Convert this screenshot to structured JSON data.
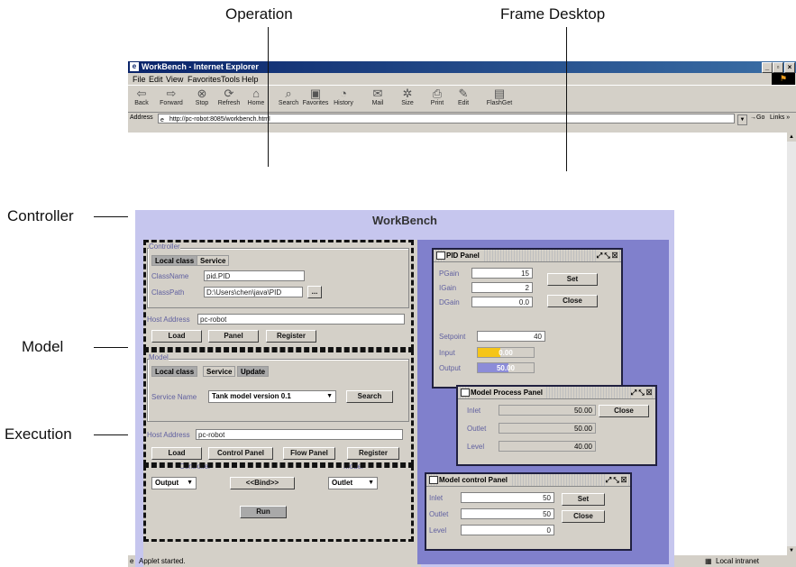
{
  "callouts": {
    "operation": "Operation",
    "frame_desktop": "Frame Desktop",
    "controller": "Controller",
    "model": "Model",
    "execution": "Execution"
  },
  "browser": {
    "title": "WorkBench - Internet Explorer",
    "menu": [
      "File",
      "Edit",
      "View",
      "Favorites",
      "Tools",
      "Help"
    ],
    "toolbar": [
      {
        "label": "Back",
        "icon": "back-arrow-icon"
      },
      {
        "label": "Forward",
        "icon": "forward-arrow-icon"
      },
      {
        "label": "Stop",
        "icon": "stop-icon"
      },
      {
        "label": "Refresh",
        "icon": "refresh-icon"
      },
      {
        "label": "Home",
        "icon": "home-icon"
      },
      {
        "label": "Search",
        "icon": "search-icon"
      },
      {
        "label": "Favorites",
        "icon": "favorites-icon"
      },
      {
        "label": "History",
        "icon": "history-icon"
      },
      {
        "label": "Mail",
        "icon": "mail-icon"
      },
      {
        "label": "Size",
        "icon": "size-icon"
      },
      {
        "label": "Print",
        "icon": "print-icon"
      },
      {
        "label": "Edit",
        "icon": "edit-icon"
      },
      {
        "label": "FlashGet",
        "icon": "flashget-icon"
      }
    ],
    "address_label": "Address",
    "url": "http://pc-robot:8085/workbench.html",
    "go_label": "Go",
    "links_label": "Links",
    "status_left": "Applet started.",
    "status_right": "Local intranet"
  },
  "app": {
    "title": "WorkBench",
    "controller": {
      "group_label": "Controller",
      "tabs": [
        "Local class",
        "Service"
      ],
      "classname_label": "ClassName",
      "classname_value": "pid.PID",
      "classpath_label": "ClassPath",
      "classpath_value": "D:\\Users\\chen\\java\\PID",
      "browse_label": "...",
      "host_label": "Host Address",
      "host_value": "pc-robot",
      "buttons": [
        "Load",
        "Panel",
        "Register"
      ]
    },
    "model": {
      "group_label": "Model",
      "tabs": [
        "Local class",
        "Service",
        "Update"
      ],
      "service_label": "Service Name",
      "service_value": "Tank model version 0.1",
      "search_label": "Search",
      "host_label": "Host Address",
      "host_value": "pc-robot",
      "buttons": [
        "Load",
        "Control Panel",
        "Flow Panel",
        "Register"
      ]
    },
    "execution": {
      "controller_label": "Controller",
      "model_label": "Model",
      "output_value": "Output",
      "bind_label": "<<Bind>>",
      "outlet_value": "Outlet",
      "run_label": "Run"
    },
    "pid_panel": {
      "title": "PID Panel",
      "pgain_label": "PGain",
      "pgain": "15",
      "igain_label": "IGain",
      "igain": "2",
      "dgain_label": "DGain",
      "dgain": "0.0",
      "set_label": "Set",
      "close_label": "Close",
      "setpoint_label": "Setpoint",
      "setpoint": "40",
      "input_label": "Input",
      "input": "0.00",
      "output_label": "Output",
      "output": "50.00"
    },
    "model_process_panel": {
      "title": "Model Process Panel",
      "inlet_label": "Inlet",
      "inlet": "50.00",
      "outlet_label": "Outlet",
      "outlet": "50.00",
      "level_label": "Level",
      "level": "40.00",
      "close_label": "Close"
    },
    "model_control_panel": {
      "title": "Model control Panel",
      "inlet_label": "Inlet",
      "inlet": "50",
      "outlet_label": "Outlet",
      "outlet": "50",
      "level_label": "Level",
      "level": "0",
      "set_label": "Set",
      "close_label": "Close"
    }
  },
  "colors": {
    "applet_bg": "#c6c6ee",
    "desktop_bg": "#8080cc",
    "input_fill": "#f5c518",
    "output_fill": "#8c8cd8"
  }
}
